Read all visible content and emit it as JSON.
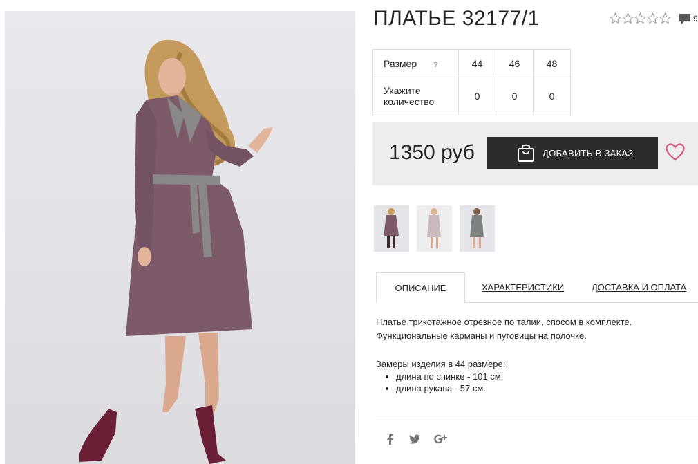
{
  "product": {
    "title": "ПЛАТЬЕ 32177/1",
    "rating_stars": 5,
    "rating_value": 0,
    "comment_count": "9"
  },
  "sizes": {
    "size_label": "Размер",
    "help_mark": "?",
    "quantity_label": "Укажите количество",
    "columns": [
      {
        "size": "44",
        "qty": "0"
      },
      {
        "size": "46",
        "qty": "0"
      },
      {
        "size": "48",
        "qty": "0"
      }
    ]
  },
  "purchase": {
    "price": "1350 руб",
    "add_button_label": "ДОБАВИТЬ В ЗАКАЗ"
  },
  "tabs": [
    {
      "label": "ОПИСАНИЕ",
      "active": true
    },
    {
      "label": "ХАРАКТЕРИСТИКИ",
      "active": false
    },
    {
      "label": "ДОСТАВКА И ОПЛАТА",
      "active": false
    }
  ],
  "description": {
    "line1": "Платье трикотажное отрезное по талии, спосом в комплекте.",
    "line2": "Функциональные карманы и пуговицы на полочке.",
    "measure_title": "Замеры изделия в 44 размере:",
    "measures": [
      "длина по спинке - 101 см;",
      "длина рукава - 57 см."
    ]
  },
  "colors": {
    "dress": "#7c5a6a",
    "belt": "#8a8787",
    "shoes": "#6a1f35",
    "price_bg": "#ededed",
    "button_bg": "#2b2b2b",
    "heart": "#d65b7f"
  },
  "social": [
    "facebook-icon",
    "twitter-icon",
    "google-plus-icon"
  ]
}
